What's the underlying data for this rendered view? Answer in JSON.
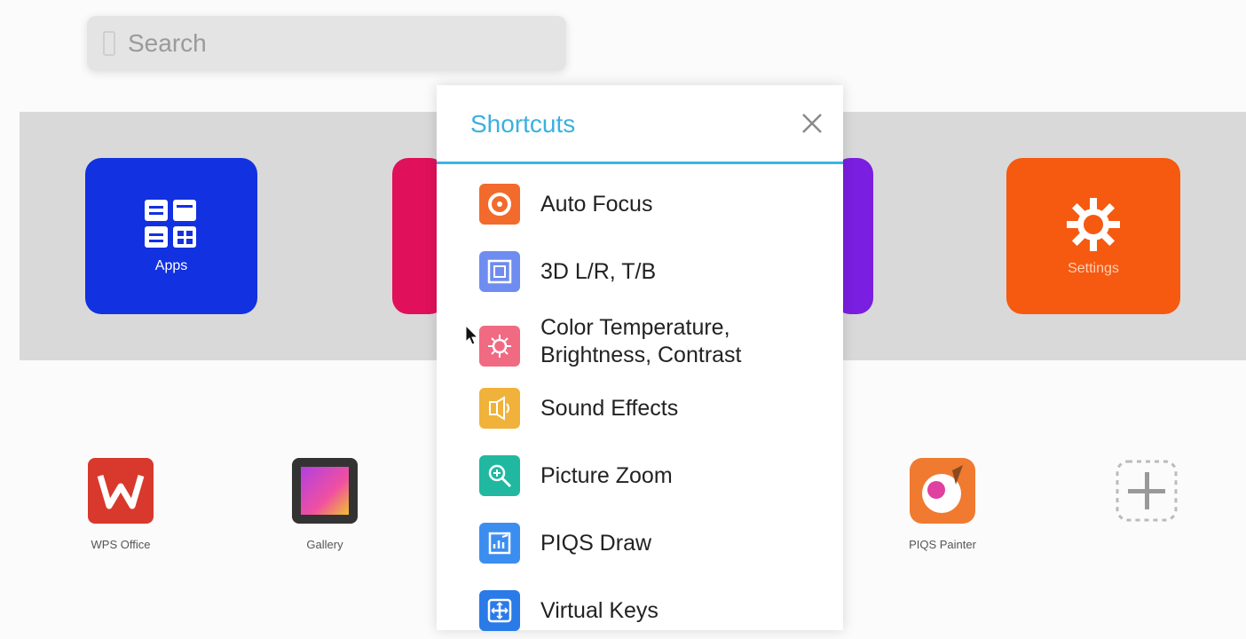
{
  "search": {
    "placeholder": "Search"
  },
  "tiles": [
    {
      "label": "Apps",
      "color": "#1231e0"
    },
    {
      "label": "",
      "color": "#e0105a"
    },
    {
      "label": "",
      "color": "#7a1ee0"
    },
    {
      "label": "Settings",
      "color": "#f55a10"
    }
  ],
  "apps": [
    {
      "label": "WPS Office",
      "icon": "wps-office-icon"
    },
    {
      "label": "Gallery",
      "icon": "gallery-icon"
    },
    {
      "label": "PIQS Painter",
      "icon": "piqs-painter-icon"
    },
    {
      "label": "",
      "icon": "add-app-icon"
    }
  ],
  "shortcuts": {
    "title": "Shortcuts",
    "items": [
      {
        "label": "Auto Focus",
        "icon": "auto-focus-icon",
        "color": "#f26a2c"
      },
      {
        "label": "3D L/R, T/B",
        "icon": "3d-icon",
        "color": "#6f8cf0"
      },
      {
        "label": "Color Temperature,",
        "label2": "Brightness, Contrast",
        "icon": "brightness-icon",
        "color": "#f06a82"
      },
      {
        "label": "Sound Effects",
        "icon": "sound-effects-icon",
        "color": "#f0b23a"
      },
      {
        "label": "Picture Zoom",
        "icon": "zoom-icon",
        "color": "#20b8a0"
      },
      {
        "label": "PIQS Draw",
        "icon": "piqs-draw-icon",
        "color": "#3b8ef0"
      },
      {
        "label": "Virtual Keys",
        "icon": "virtual-keys-icon",
        "color": "#2a7ae8"
      }
    ]
  }
}
